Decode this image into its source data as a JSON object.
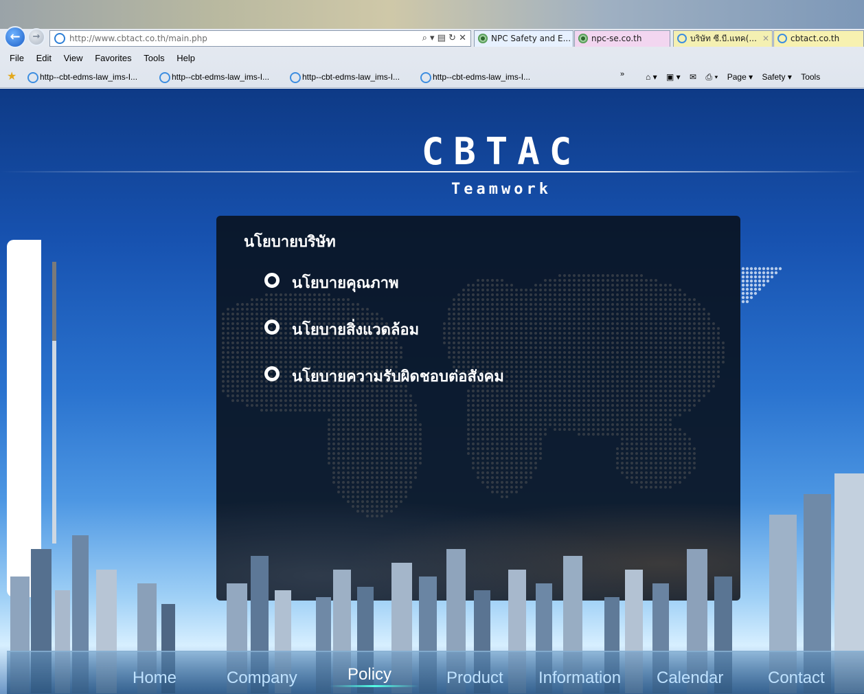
{
  "browser": {
    "address_url": "http://www.cbtact.co.th/main.php",
    "address_tools": "⌕ ▾ ▤ ↻ ✕",
    "tabs": [
      {
        "label": "NPC Safety and E...",
        "icon": "npc-favicon"
      },
      {
        "label": "npc-se.co.th",
        "icon": "npc-favicon"
      },
      {
        "label": "บริษัท ซี.บี.แทค(...",
        "icon": "ie-favicon",
        "close": "✕"
      },
      {
        "label": "cbtact.co.th",
        "icon": "ie-favicon"
      }
    ],
    "menu": [
      "File",
      "Edit",
      "View",
      "Favorites",
      "Tools",
      "Help"
    ],
    "favorites": [
      "http--cbt-edms-law_ims-I...",
      "http--cbt-edms-law_ims-I...",
      "http--cbt-edms-law_ims-I...",
      "http--cbt-edms-law_ims-I..."
    ],
    "favorites_overflow": "»",
    "command_bar": [
      "⌂ ▾",
      "▣ ▾",
      "✉",
      "⎙ ▾",
      "Page ▾",
      "Safety ▾",
      "Tools"
    ]
  },
  "site": {
    "brand": "CBTAC",
    "tagline": "Teamwork",
    "policy_box": {
      "title": "นโยบายบริษัท",
      "items": [
        "นโยบายคุณภาพ",
        "นโยบายสิ่งแวดล้อม",
        "นโยบายความรับผิดชอบต่อสังคม"
      ]
    },
    "nav": {
      "items": [
        "Home",
        "Company",
        "Policy",
        "Product",
        "Information",
        "Calendar",
        "Contact"
      ],
      "active": "Policy"
    }
  },
  "colors": {
    "nav_text": "#bfe2ff",
    "nav_active": "#ffffff",
    "content_box": "#0a1423",
    "sky_top": "#0e3a86"
  }
}
